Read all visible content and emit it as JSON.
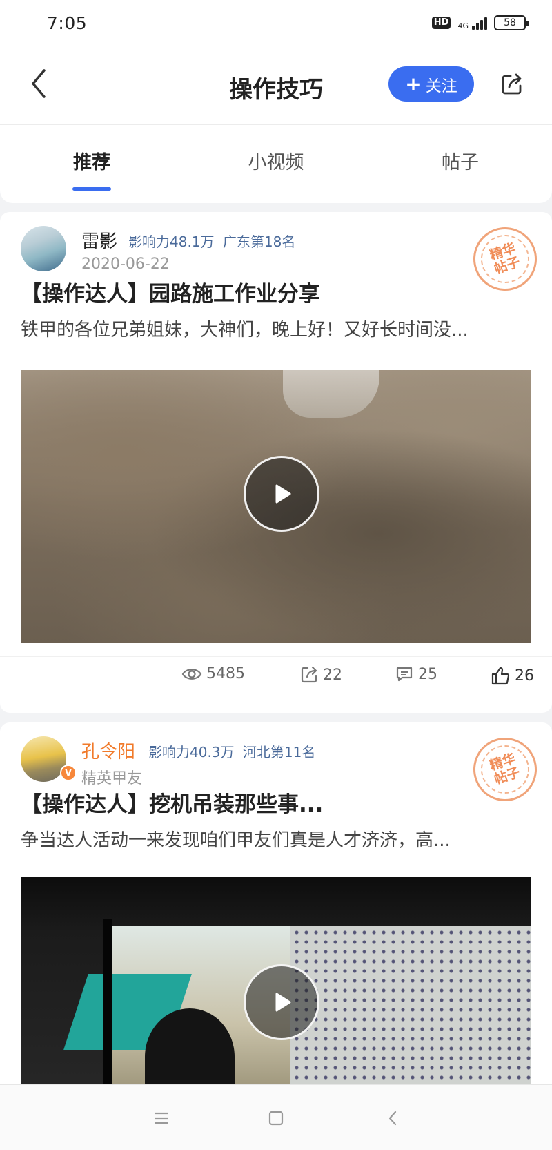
{
  "status_bar": {
    "time": "7:05",
    "hd": "HD",
    "network": "4G",
    "battery": "58"
  },
  "header": {
    "title": "操作技巧",
    "follow_label": "关注",
    "follow_icon": "plus-icon",
    "back_icon": "chevron-left-icon",
    "share_icon": "share-icon"
  },
  "tabs": [
    {
      "label": "推荐",
      "active": true
    },
    {
      "label": "小视频",
      "active": false
    },
    {
      "label": "帖子",
      "active": false
    }
  ],
  "posts": [
    {
      "author": "雷影",
      "author_color": "#222222",
      "influence": "影响力48.1万",
      "rank": "广东第18名",
      "subline": "2020-06-22",
      "badge": "精华帖子",
      "title": "【操作达人】园路施工作业分享",
      "excerpt": "铁甲的各位兄弟姐妹，大神们，晚上好！又好长时间没...",
      "stats": {
        "views": "5485",
        "shares": "22",
        "comments": "25",
        "likes": "26"
      }
    },
    {
      "author": "孔令阳",
      "author_color": "#f17a2a",
      "influence": "影响力40.3万",
      "rank": "河北第11名",
      "subline": "精英甲友",
      "verified_badge": "V",
      "badge": "精华帖子",
      "title": "【操作达人】挖机吊装那些事...",
      "excerpt": "争当达人活动一来发现咱们甲友们真是人才济济，高..."
    }
  ],
  "colors": {
    "accent": "#3a6df0",
    "stamp": "#f08c57",
    "info_text": "#4a6a9a"
  }
}
